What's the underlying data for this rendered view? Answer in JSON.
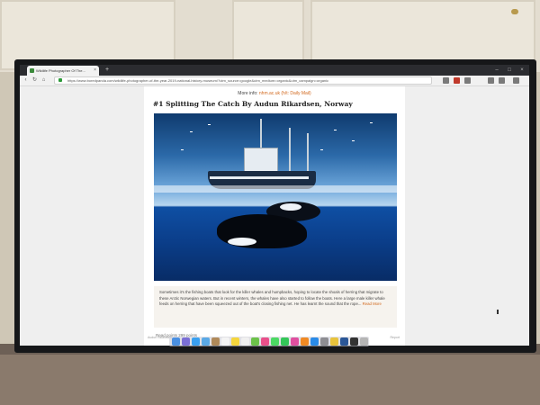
{
  "browser": {
    "tab_title": "Wildlife Photographer Of The...",
    "url": "https://www.boredpanda.com/wildlife-photographer-of-the-year-2019-national-history-museum/?utm_source=google&utm_medium=organic&utm_campaign=organic"
  },
  "article": {
    "more_info_prefix": "More info:",
    "more_info_links": "nhm.ac.uk (h/t: Daily Mail)",
    "title": "#1 Splitting The Catch By Audun Rikardsen, Norway",
    "photo_icon": "killer-whales-fishing-boat-photo",
    "caption": "Sometimes it's the fishing boats that look for the killer whales and humpbacks, hoping to locate the shoals of herring that migrate to these Arctic Norwegian waters. But in recent winters, the whales have also started to follow the boats. Here a large male killer whale feeds on herring that have been squeezed out of the boat's closing fishing net. He has learnt the sound that the rope...",
    "read_more": "Read More",
    "credit_left": "Audun Rikardsen",
    "credit_right": "Report",
    "points": "Read points 299 points"
  },
  "colors": {
    "accent": "#d2691e",
    "tabbar": "#2b2c30"
  },
  "dock_icons": [
    "finder",
    "launchpad",
    "safari",
    "mail",
    "contacts",
    "calendar",
    "notes",
    "reminders",
    "maps",
    "photos",
    "messages",
    "facetime",
    "itunes",
    "ibooks",
    "appstore",
    "preferences",
    "chrome",
    "word",
    "terminal",
    "trash"
  ]
}
